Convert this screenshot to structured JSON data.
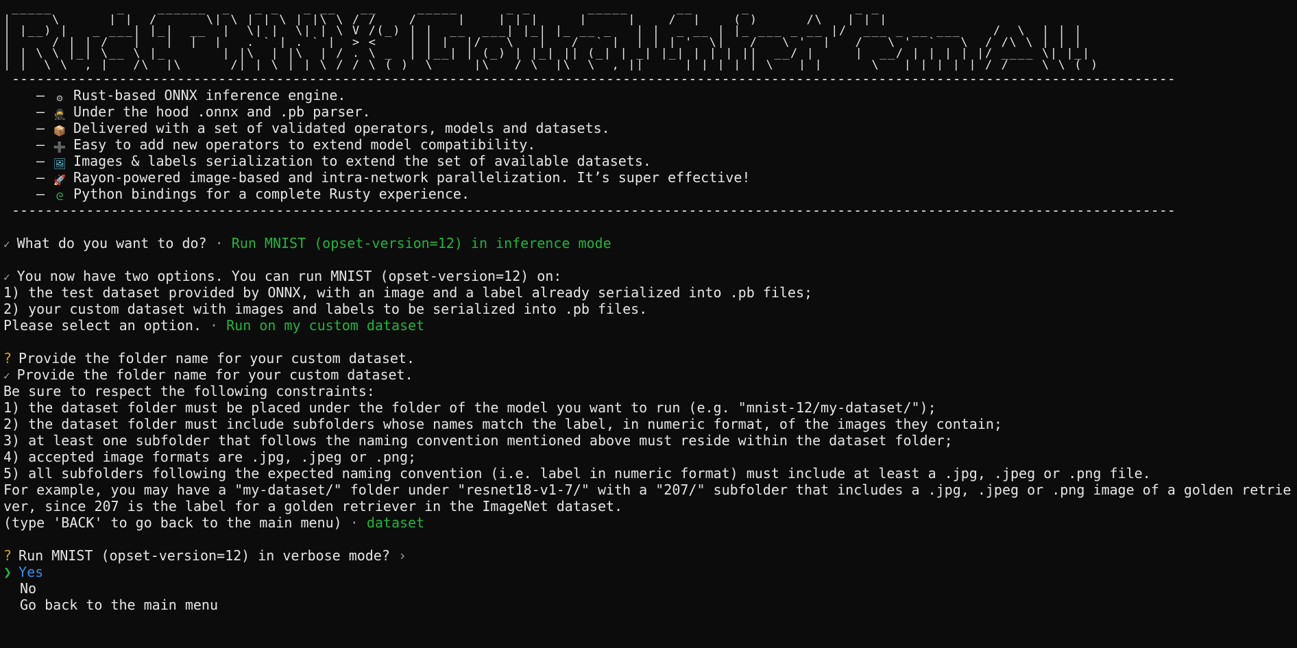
{
  "banner": {
    "lines": [
      " _____        _    ______  _   _ _   _ __   __     _____      _ _       _____      __      _             _ _ ",
      "|  __ \\      | |  /      \\| \\ | | \\ | |\\ \\ / /_   / ____|    | | |     |_   _|    / _|    ( )      /\\   | | |",
      "| |__) |   _ ___| |_|  __  |  \\| |  \\| | \\ V /(_) | |  __  ___| |_| |_ __ _   | |  _ __ | |_ ___ _ __ |/  ___ _ __ ___    /  \\  | | |",
      "|  _  / | | / __| __|  |__|   . ` | . ` |  > <    | | |_ |/ _ \\ __| __/ _` |  | | | '_ \\|  _/ _ \\ '__|   / _ \\ '_ ` _ \\  / /\\ \\ | | |",
      "| | \\ \\ |_| \\__ \\ |_       | |\\  | |\\  | / . \\ _  | |__| | (_) | |_| || (_| | _| |_| | | | ||  __/ |     |  __/ | | | | |/ ____ \\| |_|",
      "|_|  \\_\\__,_|___/\\__|\\______/|_| \\_|_| \\_/_/ \\_(_)  \\_____|\\___/ \\__|\\__\\__,_||_____|_| |_|_| \\___|_|      \\___|_| |_| |_/_/    \\_\\_(_)"
    ]
  },
  "rule": "---------------------------------------------------------------------------------------------------------------------------------------------",
  "features": [
    {
      "icon": "gear-icon",
      "glyph": "⚙",
      "color": "#b9b9b9",
      "text": "Rust-based ONNX inference engine."
    },
    {
      "icon": "ninja-icon",
      "glyph": "🥷",
      "color": "#7a5ab8",
      "text": "Under the hood .onnx and .pb parser."
    },
    {
      "icon": "package-icon",
      "glyph": "📦",
      "color": "#d9a441",
      "text": "Delivered with a set of validated operators, models and datasets."
    },
    {
      "icon": "plus-icon",
      "glyph": "➕",
      "color": "#7fa4d8",
      "text": "Easy to add new operators to extend model compatibility."
    },
    {
      "icon": "picture-icon",
      "glyph": "🖼",
      "color": "#6cc0d6",
      "text": "Images & labels serialization to extend the set of available datasets."
    },
    {
      "icon": "rocket-icon",
      "glyph": "🚀",
      "color": "#d84b4b",
      "text": "Rayon-powered image-based and intra-network parallelization. It’s super effective!"
    },
    {
      "icon": "python-icon",
      "glyph": "ᘓ",
      "color": "#2fc66b",
      "text": "Python bindings for a complete Rusty experience."
    }
  ],
  "dash": "–",
  "colors": {
    "background": "#0c0c0c",
    "text": "#e6e6e6",
    "answer_green": "#22b53b",
    "question_yellow": "#d7a31a",
    "selected_blue": "#3b8ee8",
    "banner_accent": "#e02020"
  },
  "prompts": {
    "q1": {
      "mark": "✓",
      "question": "What do you want to do?",
      "sep": "·",
      "answer": "Run MNIST (opset-version=12) in inference mode"
    },
    "q2": {
      "mark": "✓",
      "question": "You now have two options. You can run MNIST (opset-version=12) on:",
      "lines": [
        "1) the test dataset provided by ONNX, with an image and a label already serialized into .pb files;",
        "2) your custom dataset with images and labels to be serialized into .pb files."
      ],
      "final": "Please select an option.",
      "sep": "·",
      "answer": "Run on my custom dataset"
    },
    "q3": {
      "pending_mark": "?",
      "pending_question": "Provide the folder name for your custom dataset.",
      "mark": "✓",
      "question": "Provide the folder name for your custom dataset.",
      "lines": [
        "Be sure to respect the following constraints:",
        "1) the dataset folder must be placed under the folder of the model you want to run (e.g. \"mnist-12/my-dataset/\");",
        "2) the dataset folder must include subfolders whose names match the label, in numeric format, of the images they contain;",
        "3) at least one subfolder that follows the naming convention mentioned above must reside within the dataset folder;",
        "4) accepted image formats are .jpg, .jpeg or .png;",
        "5) all subfolders following the expected naming convention (i.e. label in numeric format) must include at least a .jpg, .jpeg or .png file.",
        "For example, you may have a \"my-dataset/\" folder under \"resnet18-v1-7/\" with a \"207/\" subfolder that includes a .jpg, .jpeg or .png image of a golden retrie",
        "ver, since 207 is the label for a golden retriever in the ImageNet dataset."
      ],
      "final": "(type 'BACK' to go back to the main menu)",
      "sep": "·",
      "answer": "dataset"
    },
    "q4": {
      "mark": "?",
      "question": "Run MNIST (opset-version=12) in verbose mode?",
      "arrow": "›",
      "selected_marker": "❯",
      "options": [
        "Yes",
        "No",
        "Go back to the main menu"
      ]
    }
  }
}
